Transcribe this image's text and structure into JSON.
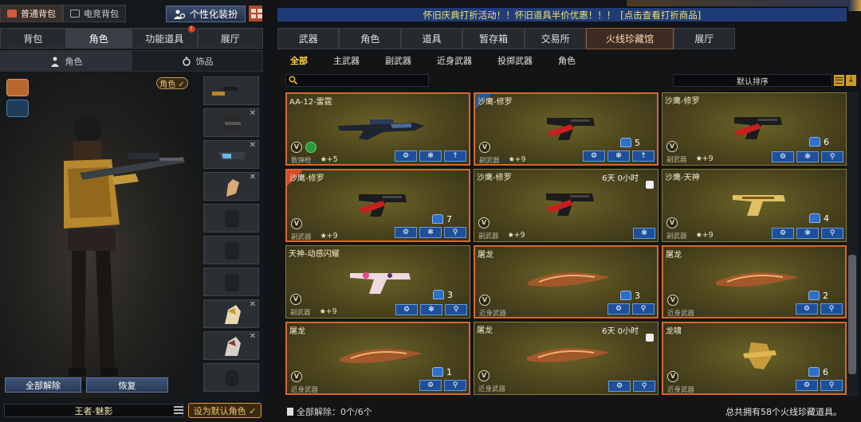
{
  "bag_tabs": [
    "普通背包",
    "电竞背包"
  ],
  "customize_label": "个性化装扮",
  "left_tabs": [
    "背包",
    "角色",
    "功能道具",
    "展厅"
  ],
  "left_tab_badge": "!",
  "left_subtabs": [
    "角色",
    "饰品"
  ],
  "role_badge": "角色 ✓",
  "left_buttons": {
    "unequip_all": "全部解除",
    "restore": "恢复"
  },
  "character_name": "王者-魅影",
  "set_default_label": "设为默认角色 ✓",
  "banner": {
    "text": "怀旧庆典打折活动！！怀旧道具半价优惠！！！",
    "link": "[点击查看打折商品]"
  },
  "right_tabs": [
    "武器",
    "角色",
    "道具",
    "暂存箱",
    "交易所",
    "火线珍藏馆",
    "展厅"
  ],
  "right_subtabs": [
    "全部",
    "主武器",
    "副武器",
    "近身武器",
    "投掷武器",
    "角色"
  ],
  "sort_label": "默认排序",
  "cards": [
    {
      "name": "AA-12-雷霆",
      "category": "散弹枪",
      "level": "+5",
      "count": "",
      "time": "",
      "buttons": [
        "gear-wrench",
        "gear",
        "up"
      ],
      "green": true
    },
    {
      "name": "沙鹰-修罗",
      "category": "副武器",
      "level": "+9",
      "count": "5",
      "time": "",
      "buttons": [
        "gear-wrench",
        "gear",
        "up"
      ],
      "ribbon": "blue"
    },
    {
      "name": "沙鹰-修罗",
      "category": "副武器",
      "level": "+9",
      "count": "6",
      "time": "",
      "buttons": [
        "gear-wrench",
        "gear",
        "search"
      ]
    },
    {
      "name": "沙鹰-修罗",
      "category": "副武器",
      "level": "+9",
      "count": "7",
      "time": "",
      "buttons": [
        "gear-wrench",
        "gear",
        "search"
      ],
      "ribbon": "red"
    },
    {
      "name": "沙鹰-修罗",
      "category": "副武器",
      "level": "+9",
      "count": "",
      "time": "6天 0小时",
      "buttons": [
        "gear"
      ]
    },
    {
      "name": "沙鹰-天神",
      "category": "副武器",
      "level": "+9",
      "count": "4",
      "time": "",
      "buttons": [
        "gear-wrench",
        "gear",
        "search"
      ]
    },
    {
      "name": "天神-动感闪耀",
      "category": "副武器",
      "level": "+9",
      "count": "3",
      "time": "",
      "buttons": [
        "gear-wrench",
        "gear",
        "search"
      ]
    },
    {
      "name": "屠龙",
      "category": "近身武器",
      "level": "",
      "count": "3",
      "time": "",
      "buttons": [
        "gear-wrench",
        "search"
      ]
    },
    {
      "name": "屠龙",
      "category": "近身武器",
      "level": "",
      "count": "2",
      "time": "",
      "buttons": [
        "gear-wrench",
        "search"
      ]
    },
    {
      "name": "屠龙",
      "category": "近身武器",
      "level": "",
      "count": "1",
      "time": "",
      "buttons": [
        "gear-wrench",
        "search"
      ]
    },
    {
      "name": "屠龙",
      "category": "近身武器",
      "level": "",
      "count": "",
      "time": "6天 0小时",
      "buttons": [
        "gear-wrench",
        "search"
      ]
    },
    {
      "name": "龙啸",
      "category": "近身武器",
      "level": "",
      "count": "6",
      "time": "",
      "buttons": [
        "gear-wrench",
        "search"
      ]
    }
  ],
  "footer_left": "全部解除：0个/6个",
  "footer_right": "总共拥有58个火线珍藏道具。"
}
